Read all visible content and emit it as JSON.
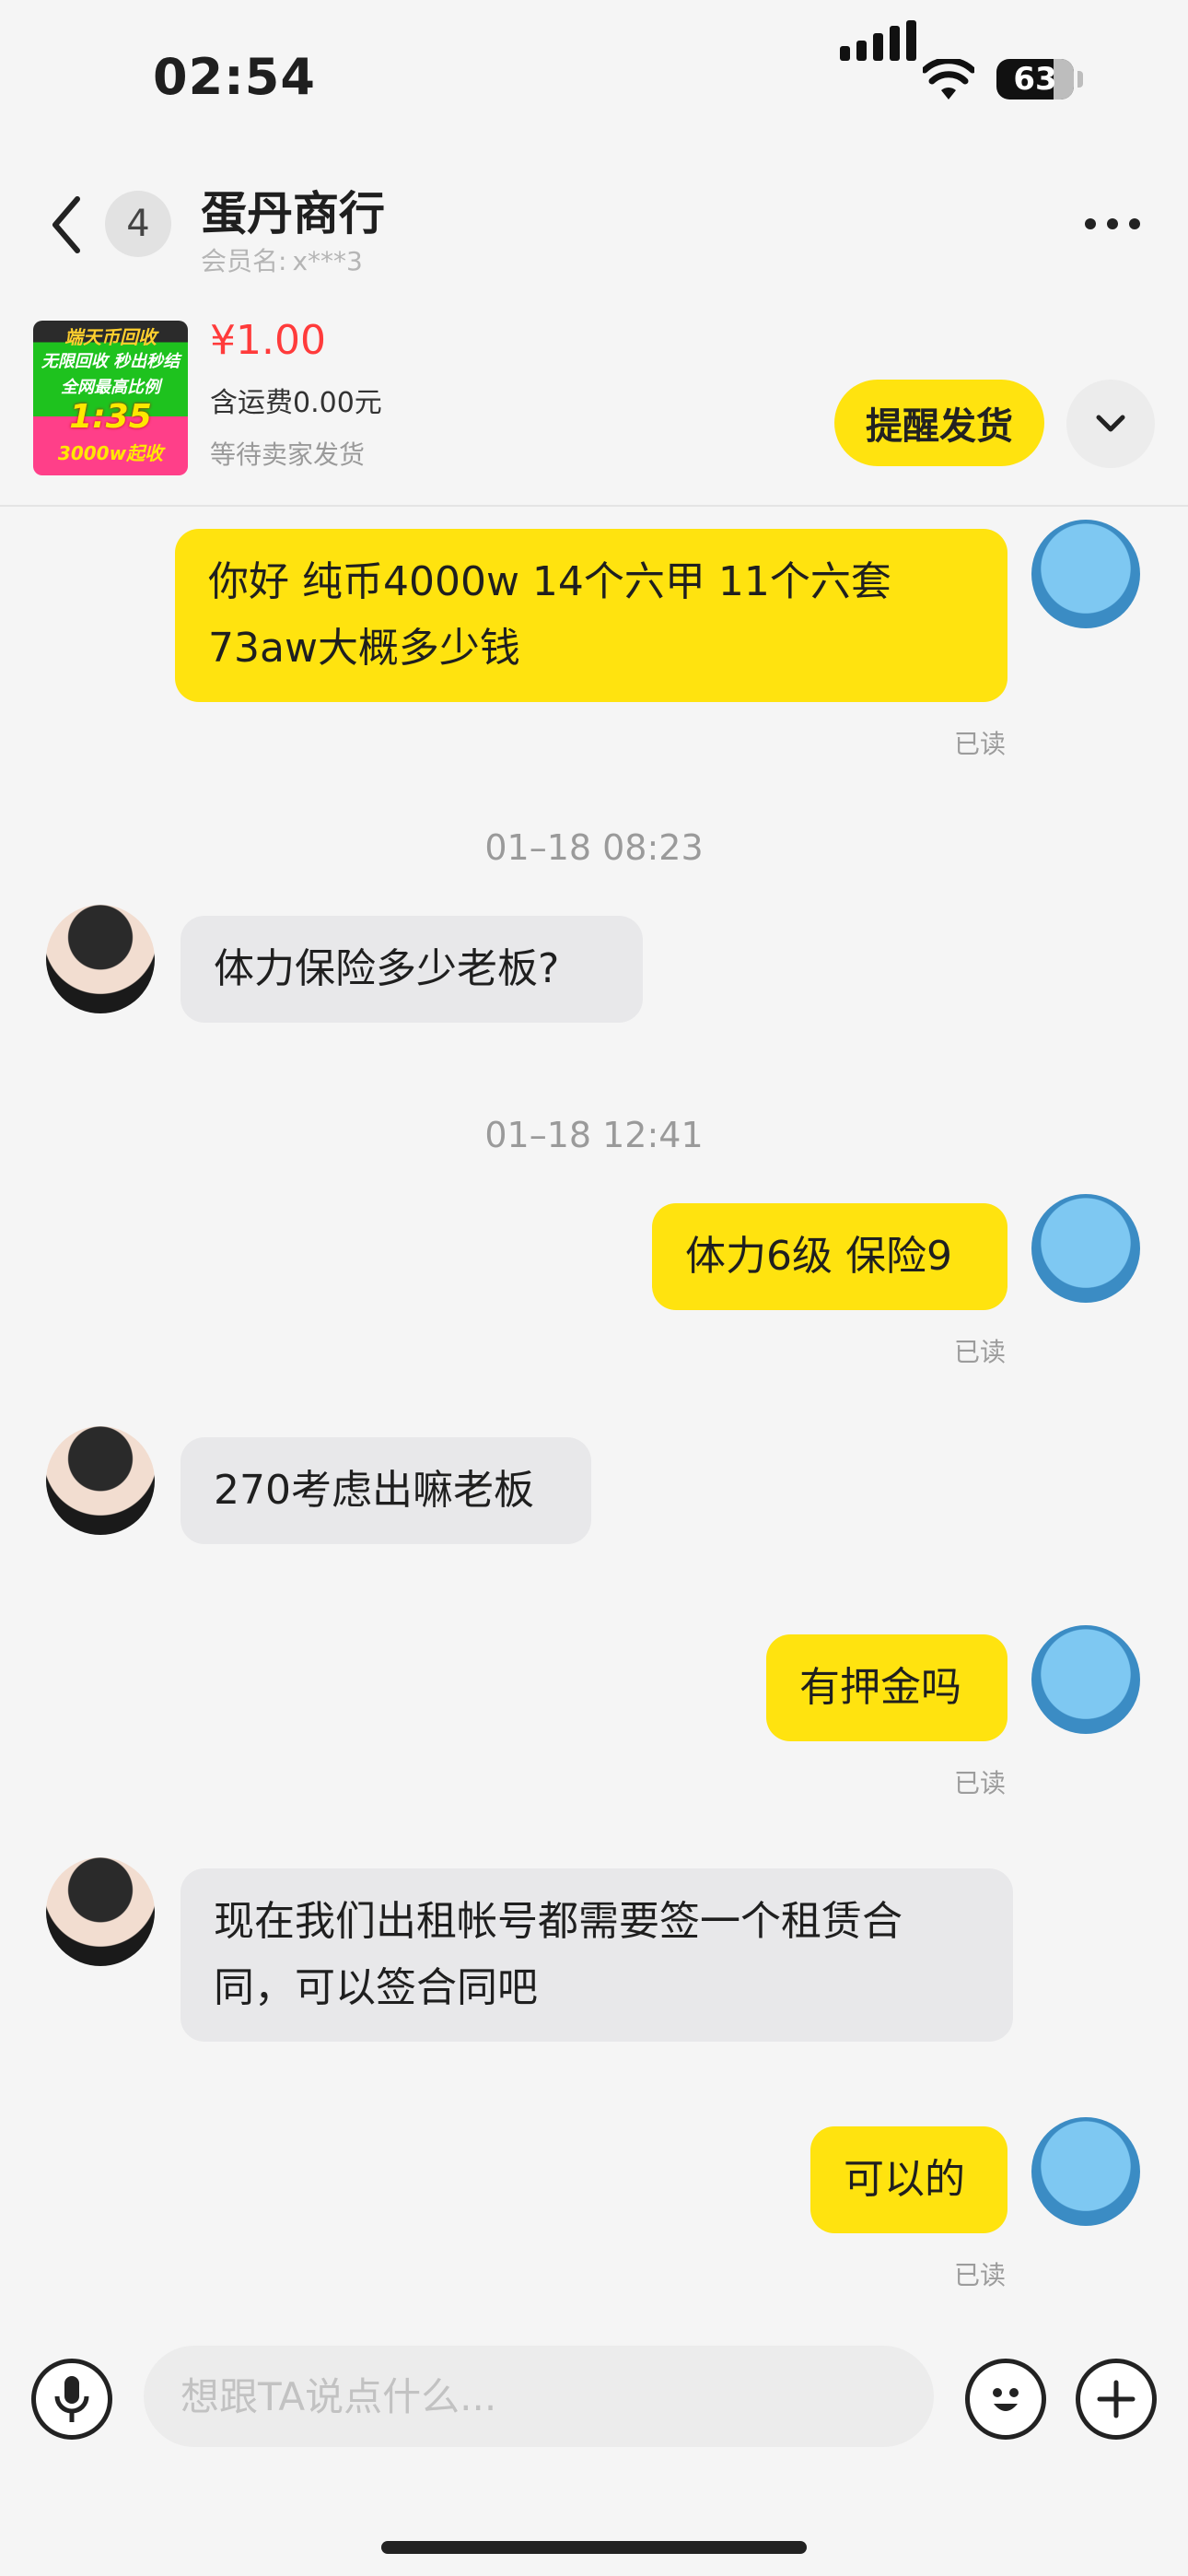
{
  "status_bar": {
    "time": "02:54",
    "battery": "63"
  },
  "header": {
    "unread_count": "4",
    "shop_name": "蛋丹商行",
    "member_label": "会员名:",
    "member_value": "x***3"
  },
  "product": {
    "thumb_text": [
      "端天币回收",
      "无限回收 秒出秒结",
      "全网最高比例",
      "1:35",
      "3000w起收"
    ],
    "price": "¥1.00",
    "shipping": "含运费0.00元",
    "status": "等待卖家发货",
    "remind_button": "提醒发货"
  },
  "messages": [
    {
      "side": "mine",
      "text": "你好 纯币4000w 14个六甲 11个六套 73aw大概多少钱",
      "read": "已读"
    },
    {
      "side": "timestamp",
      "text": "01–18 08:23"
    },
    {
      "side": "theirs",
      "text": "体力保险多少老板?"
    },
    {
      "side": "timestamp",
      "text": "01–18 12:41"
    },
    {
      "side": "mine",
      "text": "体力6级 保险9",
      "read": "已读"
    },
    {
      "side": "theirs",
      "text": "270考虑出嘛老板"
    },
    {
      "side": "mine",
      "text": "有押金吗",
      "read": "已读"
    },
    {
      "side": "theirs",
      "text": "现在我们出租帐号都需要签一个租赁合同，可以签合同吧"
    },
    {
      "side": "mine",
      "text": "可以的",
      "read": "已读"
    }
  ],
  "input": {
    "placeholder": "想跟TA说点什么..."
  },
  "icons": {
    "back": "chevron-left-icon",
    "more": "more-icon",
    "expand": "chevron-down-icon",
    "voice": "microphone-icon",
    "emoji": "smiley-icon",
    "add": "plus-icon"
  },
  "colors": {
    "accent": "#ffe30f",
    "price": "#ff3b3b",
    "bubble_theirs": "#e8e8ea"
  }
}
